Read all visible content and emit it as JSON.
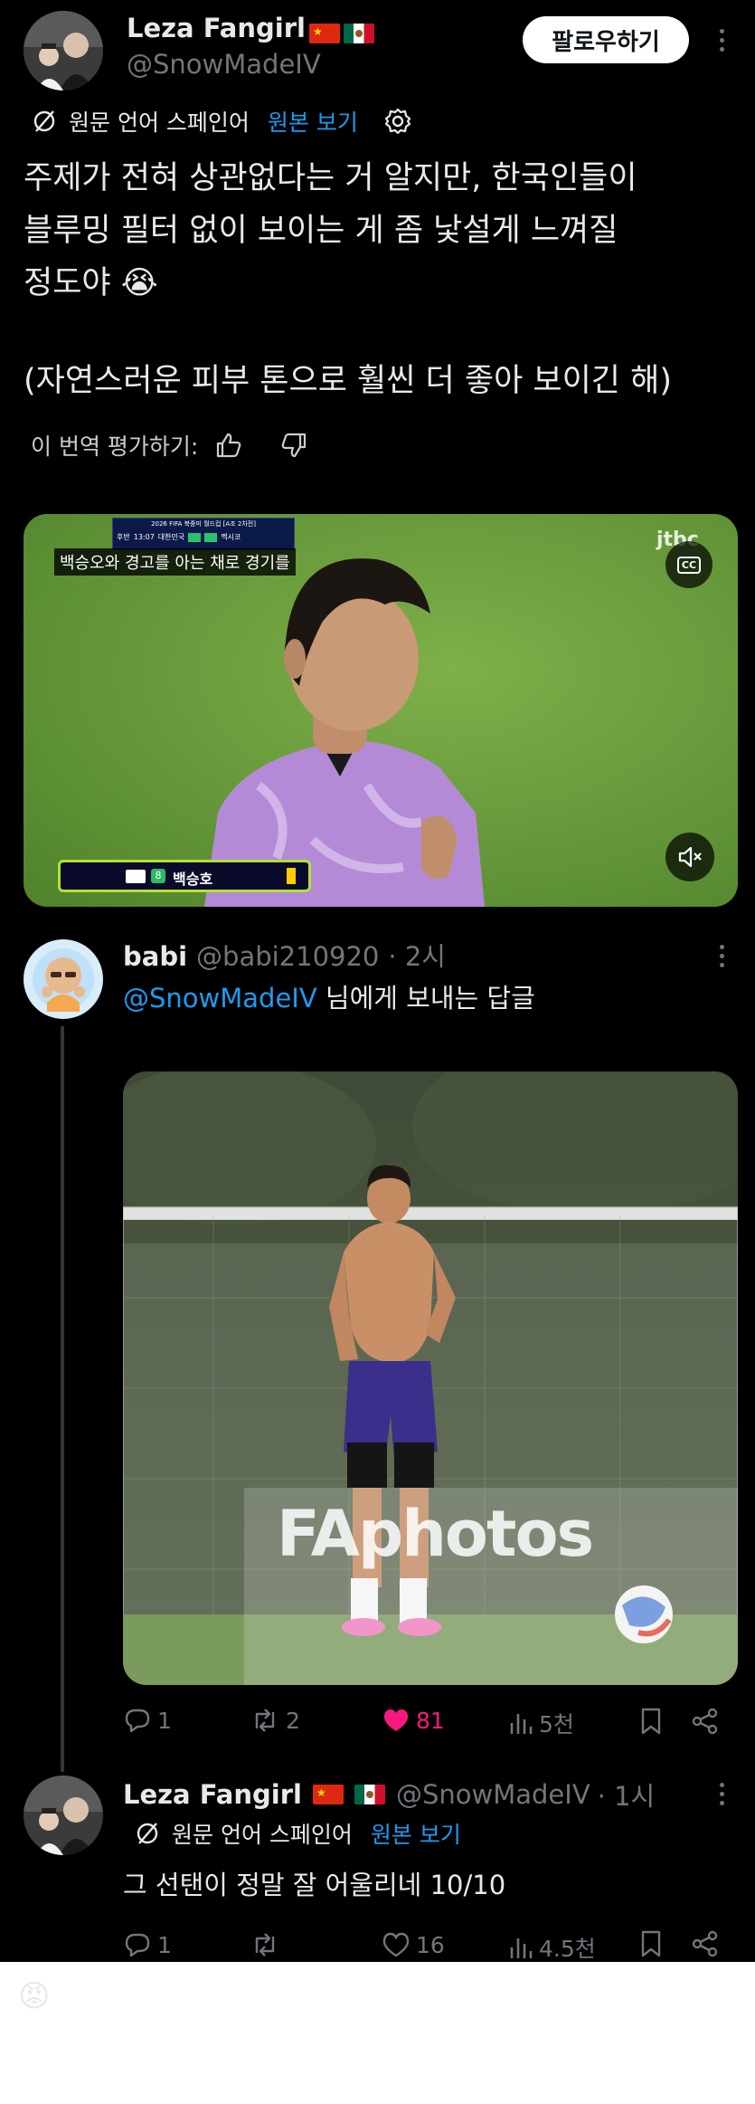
{
  "original_tweet": {
    "display_name": "Leza Fangirl",
    "handle": "@SnowMadeIV",
    "follow_label": "팔로우하기",
    "translated_label": "원문 언어 스페인어",
    "view_original": "원본 보기",
    "text_lines": [
      "주제가 전혀 상관없다는 거 알지만, 한국인들이",
      "블루밍 필터 없이 보이는 게 좀 낯설게 느껴질",
      "정도야 😭",
      "(자연스러운 피부 톤으로 훨씬 더 좋아 보이긴 해)"
    ],
    "rate_label": "이 번역 평가하기:",
    "video": {
      "caption": "백승오와 경고를 아는 채로 경기를",
      "player_name": "백승호",
      "player_number": "8",
      "scoreboard_title": "2026 FIFA 북중미 월드컵 [A조 2차전]",
      "scoreboard_time": "13:07",
      "scoreboard_team_a": "대한민국",
      "scoreboard_team_b": "멕시코",
      "scoreboard_period": "후반",
      "cc_label": "CC",
      "logo": "jtbc"
    }
  },
  "reply": {
    "display_name": "babi",
    "handle": "@babi210920",
    "time": "· 2시",
    "reply_to_handle": "@SnowMadeIV",
    "reply_to_suffix": " 님에게 보내는 답글",
    "photo_watermark": "FAphotos",
    "actions": {
      "replies": "1",
      "reposts": "2",
      "likes": "81",
      "views": "5천"
    }
  },
  "second_reply": {
    "display_name": "Leza Fangirl",
    "handle": "@SnowMadeIV",
    "time": "· 1시",
    "translated_label": "원문 언어 스페인어",
    "view_original": "원본 보기",
    "text": "그 선탠이 정말 잘 어울리네 10/10",
    "actions": {
      "replies": "1",
      "reposts": "",
      "likes": "16",
      "views": "4.5천"
    }
  },
  "footer_emoji": "😡",
  "icons": [
    "translate-icon",
    "gear-icon",
    "thumbs-up-icon",
    "thumbs-down-icon",
    "more-icon",
    "cc-icon",
    "mute-icon",
    "reply-icon",
    "repost-icon",
    "like-icon",
    "views-icon",
    "bookmark-icon",
    "share-icon"
  ],
  "colors": {
    "background": "#000000",
    "text": "#e7e9ea",
    "muted": "#71767b",
    "link": "#1d9bf0",
    "like": "#f91880"
  }
}
